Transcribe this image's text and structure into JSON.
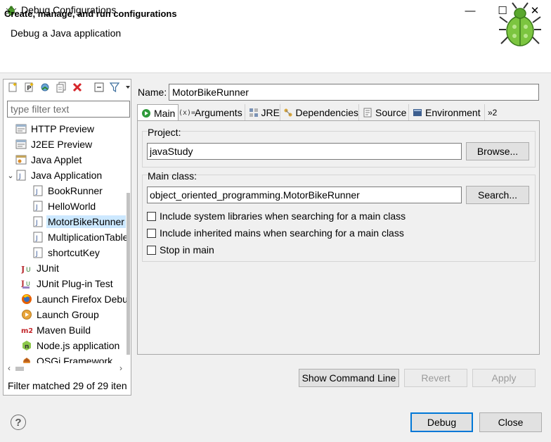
{
  "window": {
    "title": "Debug Configurations",
    "minimize": "—",
    "maximize": "☐",
    "close": "✕"
  },
  "banner": {
    "title": "Create, manage, and run configurations",
    "subtitle": "Debug a Java application"
  },
  "left": {
    "filter_placeholder": "type filter text",
    "tree": [
      {
        "label": "HTTP Preview",
        "icon": "http-preview-icon",
        "level": 1
      },
      {
        "label": "J2EE Preview",
        "icon": "j2ee-preview-icon",
        "level": 1
      },
      {
        "label": "Java Applet",
        "icon": "java-applet-icon",
        "level": 1
      },
      {
        "label": "Java Application",
        "icon": "java-application-icon",
        "level": 1,
        "expanded": true
      },
      {
        "label": "BookRunner",
        "icon": "java-class-icon",
        "level": 2
      },
      {
        "label": "HelloWorld",
        "icon": "java-class-icon",
        "level": 2
      },
      {
        "label": "MotorBikeRunner",
        "icon": "java-class-icon",
        "level": 2,
        "selected": true
      },
      {
        "label": "MultiplicationTable",
        "icon": "java-class-icon",
        "level": 2
      },
      {
        "label": "shortcutKey",
        "icon": "java-class-icon",
        "level": 2
      },
      {
        "label": "JUnit",
        "icon": "junit-icon",
        "level": 1
      },
      {
        "label": "JUnit Plug-in Test",
        "icon": "junit-plugin-icon",
        "level": 1
      },
      {
        "label": "Launch Firefox Debu",
        "icon": "firefox-icon",
        "level": 1
      },
      {
        "label": "Launch Group",
        "icon": "launch-group-icon",
        "level": 1
      },
      {
        "label": "Maven Build",
        "icon": "maven-icon",
        "level": 1
      },
      {
        "label": "Node.js application",
        "icon": "nodejs-icon",
        "level": 1
      },
      {
        "label": "OSGi Framework",
        "icon": "osgi-icon",
        "level": 1
      }
    ],
    "status": "Filter matched 29 of 29 iten"
  },
  "config": {
    "name_label": "Name:",
    "name_value": "MotorBikeRunner",
    "tabs": [
      {
        "label": "Main",
        "icon": "main-tab-icon"
      },
      {
        "label": "Arguments",
        "icon": "arguments-icon"
      },
      {
        "label": "JRE",
        "icon": "jre-icon"
      },
      {
        "label": "Dependencies",
        "icon": "dependencies-icon"
      },
      {
        "label": "Source",
        "icon": "source-icon"
      },
      {
        "label": "Environment",
        "icon": "environment-icon"
      },
      {
        "label": "»2",
        "icon": "more-tabs-icon"
      }
    ],
    "project": {
      "label": "Project:",
      "value": "javaStudy",
      "button": "Browse..."
    },
    "main_class": {
      "label": "Main class:",
      "value": "object_oriented_programming.MotorBikeRunner",
      "button": "Search...",
      "options": [
        {
          "label": "Include system libraries when searching for a main class",
          "checked": false
        },
        {
          "label": "Include inherited mains when searching for a main class",
          "checked": false
        },
        {
          "label": "Stop in main",
          "checked": false
        }
      ]
    },
    "buttons": {
      "show_command_line": "Show Command Line",
      "revert": "Revert",
      "apply": "Apply"
    }
  },
  "footer": {
    "help": "?",
    "debug": "Debug",
    "close": "Close"
  },
  "colors": {
    "selection": "#cce8ff",
    "primary_border": "#0078d7",
    "bug_green": "#6cbf2f"
  }
}
